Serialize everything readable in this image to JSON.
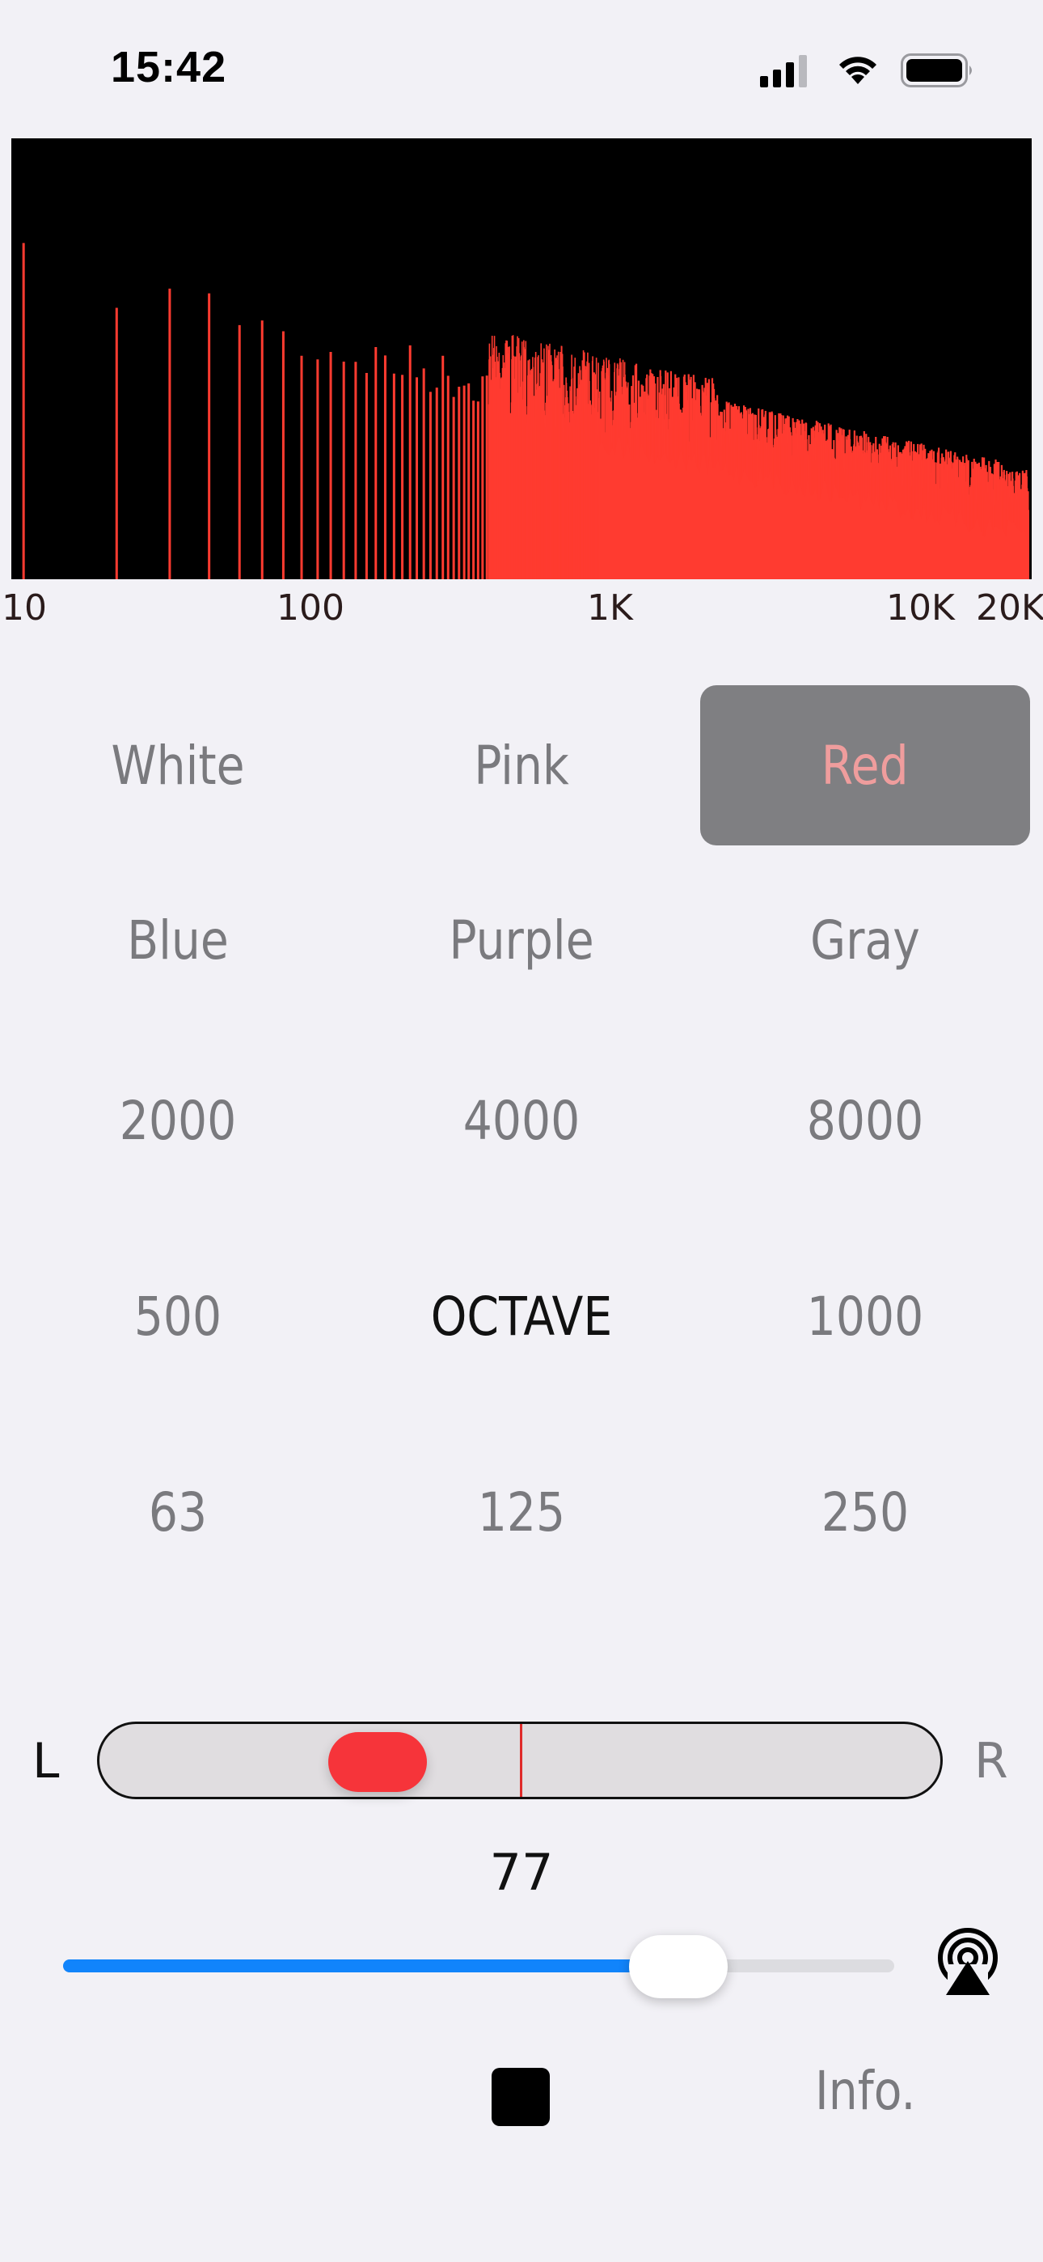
{
  "status_bar": {
    "time": "15:42",
    "icons": [
      "cellular-signal-icon",
      "wifi-icon",
      "battery-icon"
    ]
  },
  "spectrum": {
    "x_axis_labels": [
      "10",
      "100",
      "1K",
      "10K",
      "20K"
    ],
    "x_scale": "log",
    "x_range_hz": [
      10,
      20000
    ],
    "bar_color": "#ff3b30",
    "background_color": "#000000"
  },
  "noise_types": {
    "row1": [
      "White",
      "Pink",
      "Red"
    ],
    "row2": [
      "Blue",
      "Purple",
      "Gray"
    ],
    "selected": "Red"
  },
  "bands": {
    "row1": [
      "2000",
      "4000",
      "8000"
    ],
    "row2": [
      "500",
      "OCTAVE",
      "1000"
    ],
    "row3": [
      "63",
      "125",
      "250"
    ]
  },
  "balance": {
    "left_label": "L",
    "right_label": "R",
    "position": 0.3
  },
  "volume": {
    "value": "77",
    "level": 0.74
  },
  "controls": {
    "stop_icon": "stop-icon",
    "airplay_icon": "airplay-icon",
    "info_label": "Info."
  },
  "colors": {
    "accent_blue": "#1184fb",
    "accent_red": "#f6343a",
    "background": "#f2f1f6"
  }
}
